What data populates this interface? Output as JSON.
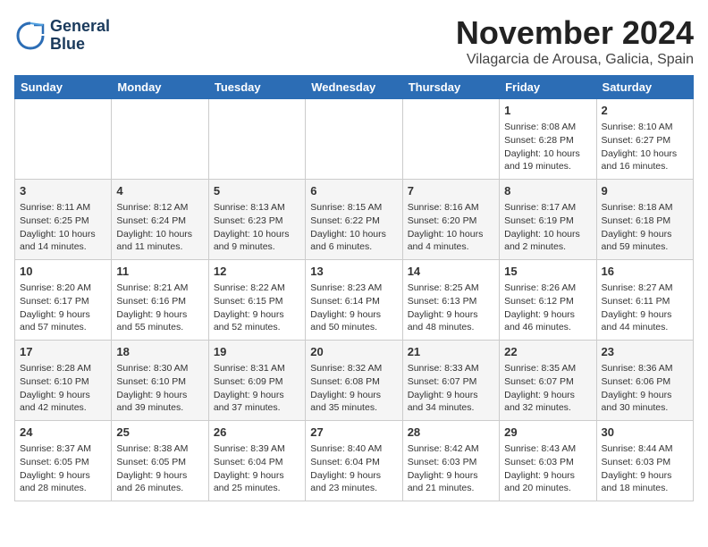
{
  "logo": {
    "line1": "General",
    "line2": "Blue"
  },
  "title": "November 2024",
  "location": "Vilagarcia de Arousa, Galicia, Spain",
  "headers": [
    "Sunday",
    "Monday",
    "Tuesday",
    "Wednesday",
    "Thursday",
    "Friday",
    "Saturday"
  ],
  "weeks": [
    [
      {
        "day": "",
        "info": ""
      },
      {
        "day": "",
        "info": ""
      },
      {
        "day": "",
        "info": ""
      },
      {
        "day": "",
        "info": ""
      },
      {
        "day": "",
        "info": ""
      },
      {
        "day": "1",
        "info": "Sunrise: 8:08 AM\nSunset: 6:28 PM\nDaylight: 10 hours and 19 minutes."
      },
      {
        "day": "2",
        "info": "Sunrise: 8:10 AM\nSunset: 6:27 PM\nDaylight: 10 hours and 16 minutes."
      }
    ],
    [
      {
        "day": "3",
        "info": "Sunrise: 8:11 AM\nSunset: 6:25 PM\nDaylight: 10 hours and 14 minutes."
      },
      {
        "day": "4",
        "info": "Sunrise: 8:12 AM\nSunset: 6:24 PM\nDaylight: 10 hours and 11 minutes."
      },
      {
        "day": "5",
        "info": "Sunrise: 8:13 AM\nSunset: 6:23 PM\nDaylight: 10 hours and 9 minutes."
      },
      {
        "day": "6",
        "info": "Sunrise: 8:15 AM\nSunset: 6:22 PM\nDaylight: 10 hours and 6 minutes."
      },
      {
        "day": "7",
        "info": "Sunrise: 8:16 AM\nSunset: 6:20 PM\nDaylight: 10 hours and 4 minutes."
      },
      {
        "day": "8",
        "info": "Sunrise: 8:17 AM\nSunset: 6:19 PM\nDaylight: 10 hours and 2 minutes."
      },
      {
        "day": "9",
        "info": "Sunrise: 8:18 AM\nSunset: 6:18 PM\nDaylight: 9 hours and 59 minutes."
      }
    ],
    [
      {
        "day": "10",
        "info": "Sunrise: 8:20 AM\nSunset: 6:17 PM\nDaylight: 9 hours and 57 minutes."
      },
      {
        "day": "11",
        "info": "Sunrise: 8:21 AM\nSunset: 6:16 PM\nDaylight: 9 hours and 55 minutes."
      },
      {
        "day": "12",
        "info": "Sunrise: 8:22 AM\nSunset: 6:15 PM\nDaylight: 9 hours and 52 minutes."
      },
      {
        "day": "13",
        "info": "Sunrise: 8:23 AM\nSunset: 6:14 PM\nDaylight: 9 hours and 50 minutes."
      },
      {
        "day": "14",
        "info": "Sunrise: 8:25 AM\nSunset: 6:13 PM\nDaylight: 9 hours and 48 minutes."
      },
      {
        "day": "15",
        "info": "Sunrise: 8:26 AM\nSunset: 6:12 PM\nDaylight: 9 hours and 46 minutes."
      },
      {
        "day": "16",
        "info": "Sunrise: 8:27 AM\nSunset: 6:11 PM\nDaylight: 9 hours and 44 minutes."
      }
    ],
    [
      {
        "day": "17",
        "info": "Sunrise: 8:28 AM\nSunset: 6:10 PM\nDaylight: 9 hours and 42 minutes."
      },
      {
        "day": "18",
        "info": "Sunrise: 8:30 AM\nSunset: 6:10 PM\nDaylight: 9 hours and 39 minutes."
      },
      {
        "day": "19",
        "info": "Sunrise: 8:31 AM\nSunset: 6:09 PM\nDaylight: 9 hours and 37 minutes."
      },
      {
        "day": "20",
        "info": "Sunrise: 8:32 AM\nSunset: 6:08 PM\nDaylight: 9 hours and 35 minutes."
      },
      {
        "day": "21",
        "info": "Sunrise: 8:33 AM\nSunset: 6:07 PM\nDaylight: 9 hours and 34 minutes."
      },
      {
        "day": "22",
        "info": "Sunrise: 8:35 AM\nSunset: 6:07 PM\nDaylight: 9 hours and 32 minutes."
      },
      {
        "day": "23",
        "info": "Sunrise: 8:36 AM\nSunset: 6:06 PM\nDaylight: 9 hours and 30 minutes."
      }
    ],
    [
      {
        "day": "24",
        "info": "Sunrise: 8:37 AM\nSunset: 6:05 PM\nDaylight: 9 hours and 28 minutes."
      },
      {
        "day": "25",
        "info": "Sunrise: 8:38 AM\nSunset: 6:05 PM\nDaylight: 9 hours and 26 minutes."
      },
      {
        "day": "26",
        "info": "Sunrise: 8:39 AM\nSunset: 6:04 PM\nDaylight: 9 hours and 25 minutes."
      },
      {
        "day": "27",
        "info": "Sunrise: 8:40 AM\nSunset: 6:04 PM\nDaylight: 9 hours and 23 minutes."
      },
      {
        "day": "28",
        "info": "Sunrise: 8:42 AM\nSunset: 6:03 PM\nDaylight: 9 hours and 21 minutes."
      },
      {
        "day": "29",
        "info": "Sunrise: 8:43 AM\nSunset: 6:03 PM\nDaylight: 9 hours and 20 minutes."
      },
      {
        "day": "30",
        "info": "Sunrise: 8:44 AM\nSunset: 6:03 PM\nDaylight: 9 hours and 18 minutes."
      }
    ]
  ]
}
